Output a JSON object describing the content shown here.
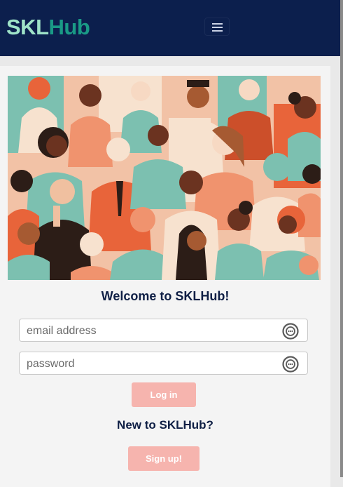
{
  "brand": {
    "part1": "SKL",
    "part2": "Hub"
  },
  "nav": {
    "toggle_icon": "hamburger-icon"
  },
  "hero": {
    "image_icon": "crowd-illustration"
  },
  "login": {
    "welcome": "Welcome to SKLHub!",
    "email_placeholder": "email address",
    "password_placeholder": "password",
    "field_icon": "password-manager-icon",
    "login_label": "Log in"
  },
  "signup": {
    "prompt": "New to SKLHub?",
    "label": "Sign up!"
  },
  "colors": {
    "navbar": "#0c1f4d",
    "brand_light": "#9fe3c8",
    "brand_dark": "#1a9a86",
    "button": "#f6b4ae"
  }
}
